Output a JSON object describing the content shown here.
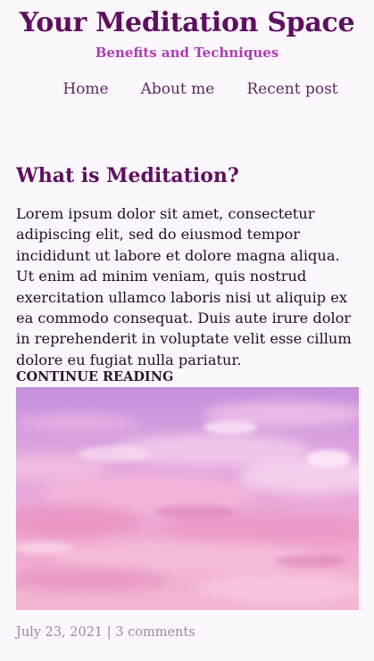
{
  "site": {
    "title": "Your Meditation Space",
    "subtitle": "Benefits and Techniques"
  },
  "nav": {
    "items": [
      {
        "label": "Home"
      },
      {
        "label": "About me"
      },
      {
        "label": "Recent post"
      }
    ]
  },
  "post": {
    "title": "What is Meditation?",
    "body": "Lorem ipsum dolor sit amet, consectetur adipiscing elit, sed do eiusmod tempor incididunt ut labore et dolore magna aliqua. Ut enim ad minim veniam, quis nostrud exercitation ullamco laboris nisi ut aliquip ex ea commodo consequat. Duis aute irure dolor in reprehenderit in voluptate velit esse cillum dolore eu fugiat nulla pariatur.",
    "continue_label": "CONTINUE READING",
    "date": "July 23, 2021",
    "separator": "|",
    "comments": "3 comments"
  },
  "colors": {
    "background": "#fbf7fd",
    "title": "#5e0f5e",
    "subtitle": "#b23ab6",
    "meta": "#9a88a6"
  },
  "image": {
    "subject": "pink-purple-cloudy-sky"
  }
}
